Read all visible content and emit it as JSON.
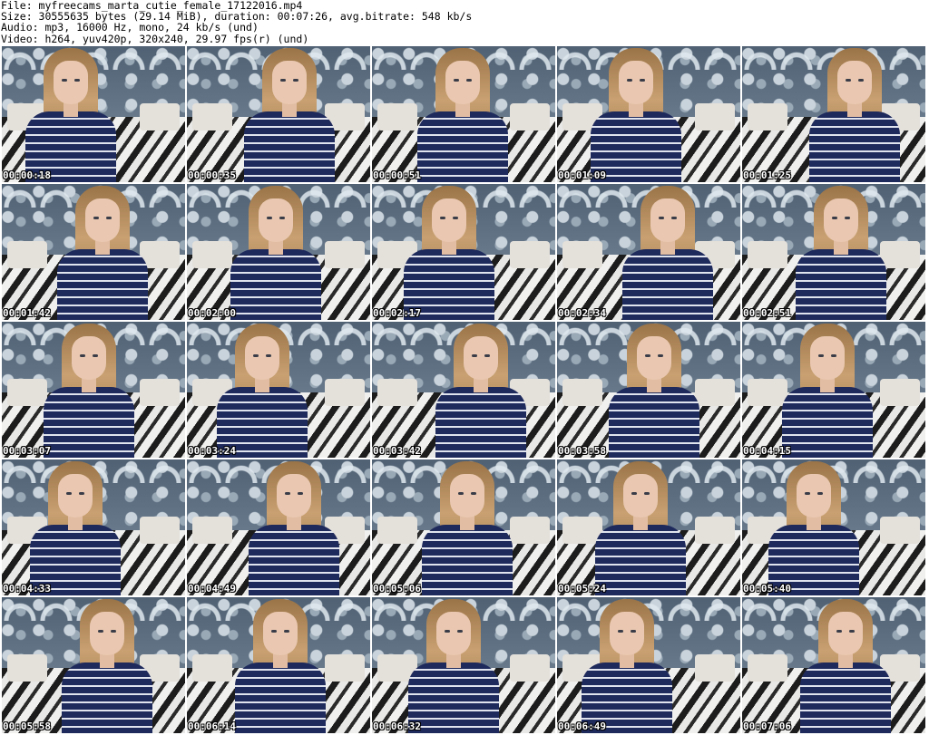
{
  "header": {
    "lines": [
      "File: myfreecams_marta_cutie_female_17122016.mp4",
      "Size: 30555635 bytes (29.14 MiB), duration: 00:07:26, avg.bitrate: 548 kb/s",
      "Audio: mp3, 16000 Hz, mono, 24 kb/s (und)",
      "Video: h264, yuv420p, 320x240, 29.97 fps(r) (und)"
    ]
  },
  "thumbnails": [
    {
      "timestamp": "00:00:18"
    },
    {
      "timestamp": "00:00:35"
    },
    {
      "timestamp": "00:00:51"
    },
    {
      "timestamp": "00:01:09"
    },
    {
      "timestamp": "00:01:25"
    },
    {
      "timestamp": "00:01:42"
    },
    {
      "timestamp": "00:02:00"
    },
    {
      "timestamp": "00:02:17"
    },
    {
      "timestamp": "00:02:34"
    },
    {
      "timestamp": "00:02:51"
    },
    {
      "timestamp": "00:03:07"
    },
    {
      "timestamp": "00:03:24"
    },
    {
      "timestamp": "00:03:42"
    },
    {
      "timestamp": "00:03:58"
    },
    {
      "timestamp": "00:04:15"
    },
    {
      "timestamp": "00:04:33"
    },
    {
      "timestamp": "00:04:49"
    },
    {
      "timestamp": "00:05:06"
    },
    {
      "timestamp": "00:05:24"
    },
    {
      "timestamp": "00:05:40"
    },
    {
      "timestamp": "00:05:58"
    },
    {
      "timestamp": "00:06:14"
    },
    {
      "timestamp": "00:06:32"
    },
    {
      "timestamp": "00:06:49"
    },
    {
      "timestamp": "00:07:06"
    }
  ]
}
